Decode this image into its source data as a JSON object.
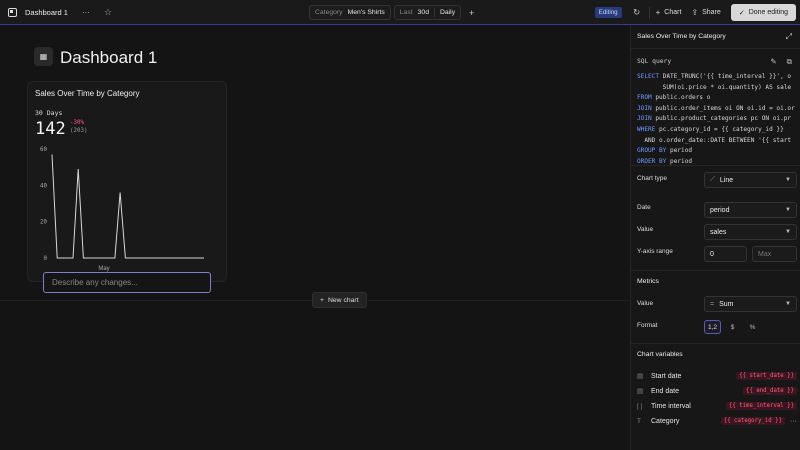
{
  "topbar": {
    "title": "Dashboard 1",
    "more_label": "···",
    "star_icon": "☆",
    "category_key": "Category",
    "category_value": "Men's Shirts",
    "range_key": "Last",
    "range_value": "30d",
    "interval_value": "Daily",
    "add_label": "+",
    "editing_label": "Editing",
    "chart_label": "Chart",
    "share_label": "Share",
    "done_label": "Done editing"
  },
  "dashboard": {
    "title": "Dashboard 1",
    "describe_placeholder": "Describe any changes...",
    "new_chart_label": "New chart"
  },
  "card": {
    "title": "Sales Over Time by Category",
    "period_label": "30 Days",
    "big_value": "142",
    "change_pct": "-30%",
    "previous_value": "(203)"
  },
  "chart_data": {
    "type": "line",
    "title": "Sales Over Time by Category",
    "xlabel": "",
    "ylabel": "",
    "x_tick_labels": [
      "May"
    ],
    "y_ticks": [
      "0",
      "20",
      "40",
      "60"
    ],
    "ylim": [
      0,
      60
    ],
    "grid": false,
    "series": [
      {
        "values": [
          57,
          0,
          0,
          0,
          0,
          49,
          0,
          0,
          0,
          0,
          0,
          0,
          0,
          36,
          0,
          0,
          0,
          0,
          0,
          0,
          0,
          0,
          0,
          0,
          0,
          0,
          0,
          0,
          0,
          0
        ]
      }
    ],
    "color": "#d8d8d8"
  },
  "panel": {
    "title": "Sales Over Time by Category",
    "sql_label": "SQL query",
    "sql_lines": [
      {
        "kw": "SELECT",
        "rest": " DATE_TRUNC('{{ time_interval }}', o"
      },
      {
        "kw": "",
        "rest": "       SUM(oi.price * oi.quantity) AS sale"
      },
      {
        "kw": "FROM",
        "rest": " public.orders o"
      },
      {
        "kw": "JOIN",
        "rest": " public.order_items oi ON oi.id = oi.or"
      },
      {
        "kw": "JOIN",
        "rest": " public.product_categories pc ON oi.pr"
      },
      {
        "kw": "WHERE",
        "rest": " pc.category_id = {{ category_id }}"
      },
      {
        "kw": "",
        "rest": "  AND o.order_date::DATE BETWEEN '{{ start"
      },
      {
        "kw": "GROUP BY",
        "rest": " period"
      },
      {
        "kw": "ORDER BY",
        "rest": " period"
      }
    ],
    "chart_type_label": "Chart type",
    "chart_type_value": "Line",
    "date_label": "Date",
    "date_value": "period",
    "value_label": "Value",
    "value_value": "sales",
    "yrange_label": "Y-axis range",
    "ymin_value": "0",
    "ymax_placeholder": "Max",
    "metrics_title": "Metrics",
    "metric_value_label": "Value",
    "metric_agg": "Sum",
    "format_label": "Format",
    "format_options": [
      "1,2",
      "$",
      "%"
    ],
    "variables_title": "Chart variables",
    "variables": [
      {
        "icon": "calendar-icon",
        "glyph": "▤",
        "name": "Start date",
        "tag": "{{ start_date }}"
      },
      {
        "icon": "calendar-icon",
        "glyph": "▤",
        "name": "End date",
        "tag": "{{ end_date }}"
      },
      {
        "icon": "bracket-icon",
        "glyph": "[ ]",
        "name": "Time interval",
        "tag": "{{ time_interval }}"
      },
      {
        "icon": "text-icon",
        "glyph": "T",
        "name": "Category",
        "tag": "{{ category_id }}"
      }
    ]
  }
}
